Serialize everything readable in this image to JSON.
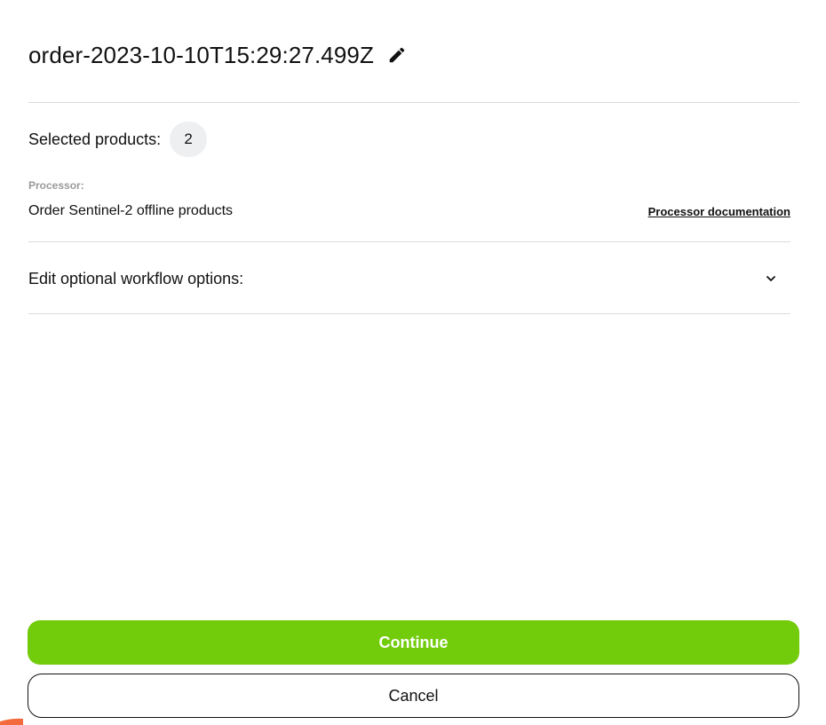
{
  "header": {
    "title": "order-2023-10-10T15:29:27.499Z",
    "edit_icon": "pencil-icon"
  },
  "selection": {
    "label": "Selected products:",
    "count": "2"
  },
  "processor": {
    "caption": "Processor:",
    "name": "Order Sentinel-2 offline products",
    "doc_link": "Processor documentation"
  },
  "workflow": {
    "label": "Edit optional workflow options:",
    "toggle_icon": "chevron-down-icon"
  },
  "actions": {
    "continue_label": "Continue",
    "cancel_label": "Cancel"
  },
  "colors": {
    "accent": "#72cc0c",
    "badge_bg": "#eeeff1",
    "divider": "#dcdcdc",
    "caption": "#9a9a9a",
    "corner_accent": "#f26a3d"
  }
}
